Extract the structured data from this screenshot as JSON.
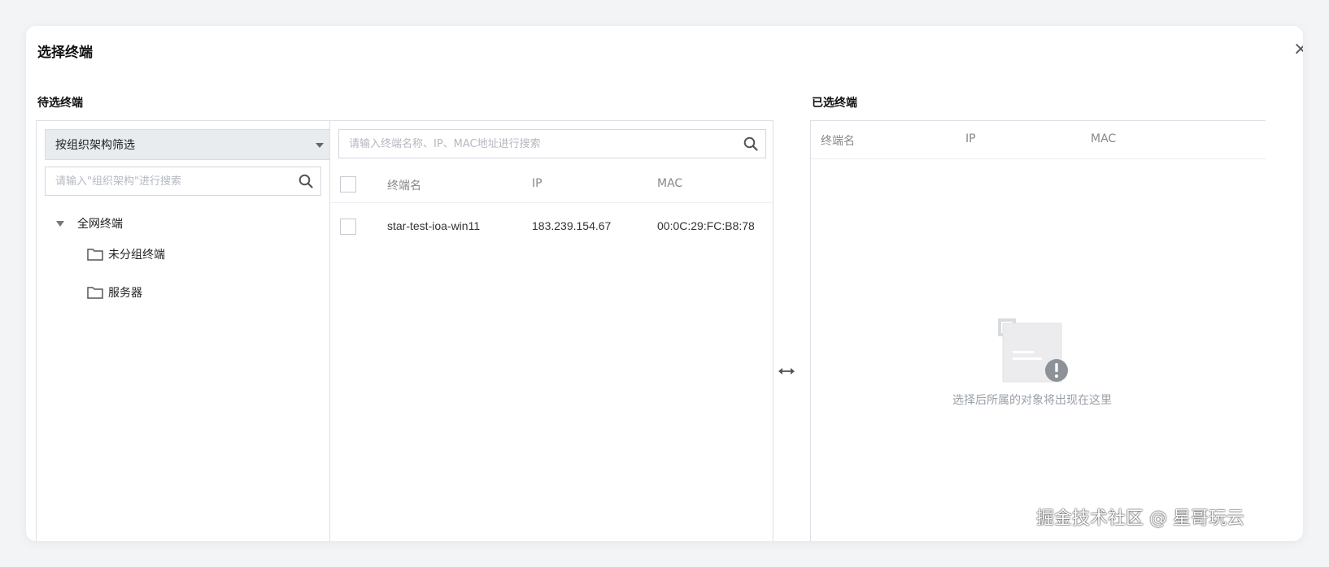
{
  "dialog": {
    "title": "选择终端",
    "close_label": "×"
  },
  "left_section": {
    "label": "待选终端",
    "filter_select": {
      "value": "按组织架构筛选"
    },
    "org_search": {
      "placeholder": "请输入\"组织架构\"进行搜索"
    },
    "tree": {
      "root": "全网终端",
      "children": [
        {
          "label": "未分组终端",
          "icon": "folder-icon"
        },
        {
          "label": "服务器",
          "icon": "folder-icon"
        }
      ]
    }
  },
  "middle_section": {
    "search": {
      "placeholder": "请输入终端名称、IP、MAC地址进行搜索"
    },
    "columns": [
      "终端名",
      "IP",
      "MAC"
    ],
    "rows": [
      {
        "name": "star-test-ioa-win11",
        "ip": "183.239.154.67",
        "mac": "00:0C:29:FC:B8:78",
        "checked": false
      }
    ]
  },
  "swap_icon": "swap-arrows-icon",
  "right_section": {
    "label": "已选终端",
    "columns": [
      "终端名",
      "IP",
      "MAC"
    ],
    "empty_text": "选择后所属的对象将出现在这里",
    "empty_icon": "empty-state-icon"
  },
  "watermark": "掘金技术社区 @ 星哥玩云"
}
